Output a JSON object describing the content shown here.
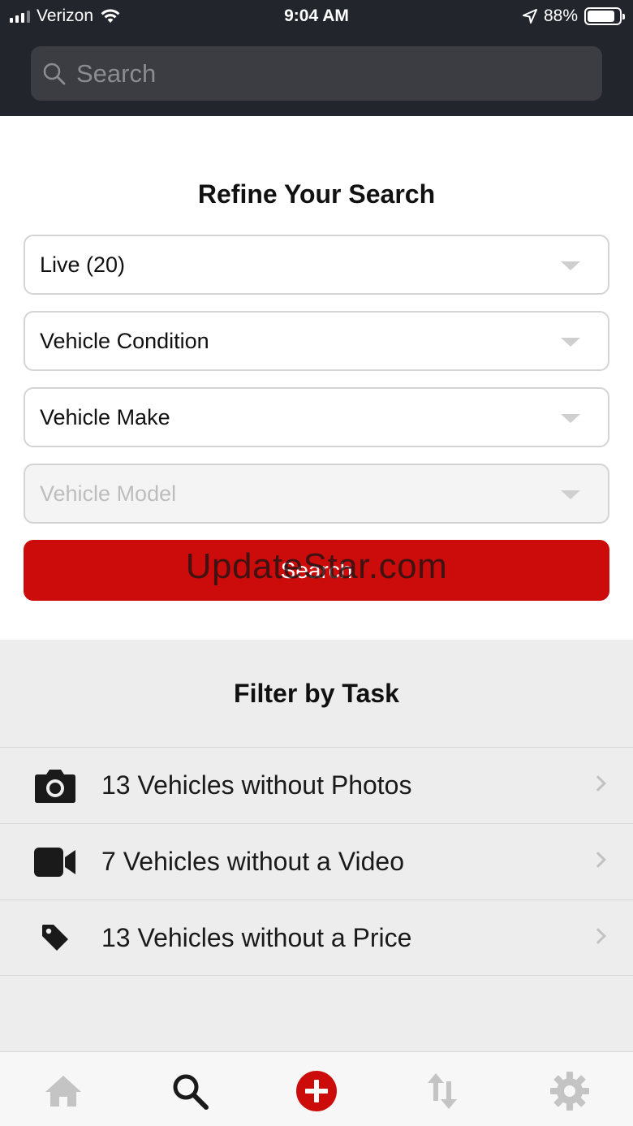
{
  "status_bar": {
    "carrier": "Verizon",
    "time": "9:04 AM",
    "battery": "88%",
    "battery_level": 0.88
  },
  "search": {
    "placeholder": "Search"
  },
  "refine": {
    "title": "Refine Your Search",
    "dropdowns": [
      {
        "value": "Live (20)",
        "disabled": false
      },
      {
        "value": "Vehicle Condition",
        "disabled": false
      },
      {
        "value": "Vehicle Make",
        "disabled": false
      },
      {
        "value": "Vehicle Model",
        "disabled": true
      }
    ],
    "search_button": "Search",
    "watermark": "UpdateStar.com"
  },
  "filter": {
    "title": "Filter by Task",
    "tasks": [
      {
        "label": "13 Vehicles without Photos",
        "icon": "camera-icon"
      },
      {
        "label": "7 Vehicles without a Video",
        "icon": "video-camera-icon"
      },
      {
        "label": "13 Vehicles without a Price",
        "icon": "price-tag-icon"
      }
    ]
  },
  "tab_bar": {
    "items": [
      "home-icon",
      "search-icon",
      "add-icon",
      "transfer-icon",
      "settings-icon"
    ],
    "active": "search-icon"
  },
  "colors": {
    "accent": "#cc0b0b",
    "header_bg": "#23252d"
  }
}
